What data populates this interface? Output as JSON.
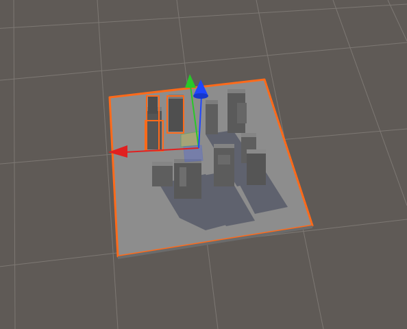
{
  "scene_view": {
    "grid": true,
    "selection": {
      "object": "ground-plane",
      "outline_color": "#ff6a1a",
      "selected_child_buildings": 2
    },
    "gizmo": {
      "tool": "move",
      "x_axis": {
        "color": "#e02020",
        "icon": "cone-icon"
      },
      "y_axis": {
        "color": "#28c828",
        "icon": "arrow-icon"
      },
      "z_axis": {
        "color": "#1e46ff",
        "icon": "cone-icon"
      }
    },
    "colors": {
      "background": "#5f5a56",
      "grid_line": "#8a8580",
      "ground": "#8c8c8c",
      "building_top": "#7c7c7c",
      "building_side": "#5a5a5a",
      "shadow": "#3a3f55"
    }
  }
}
